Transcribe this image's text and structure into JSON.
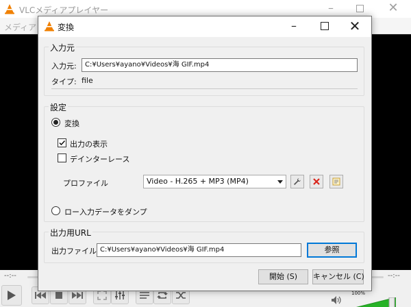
{
  "main_window": {
    "title": "VLCメディアプレイヤー",
    "menu_partial": "メディア (M",
    "time_left": "--:--",
    "time_right": "--:--",
    "volume_percent": "100%",
    "volume_level": 1.0
  },
  "dialog": {
    "title": "変換",
    "source": {
      "group_title": "入力元",
      "source_label": "入力元:",
      "source_value": "C:¥Users¥ayano¥Videos¥海  GIF.mp4",
      "type_label": "タイプ:",
      "type_value": "file"
    },
    "settings": {
      "group_title": "設定",
      "convert_label": "変換",
      "convert_selected": true,
      "show_output_label": "出力の表示",
      "show_output_checked": true,
      "deinterlace_label": "デインターレース",
      "deinterlace_checked": false,
      "profile_label": "プロファイル",
      "profile_value": "Video - H.265 + MP3 (MP4)",
      "raw_dump_label": "ロー入力データをダンプ",
      "raw_dump_selected": false
    },
    "output": {
      "group_title": "出力用URL",
      "file_label": "出力ファイル:",
      "file_value": "C:¥Users¥ayano¥Videos¥海  GIF.mp4",
      "browse_label": "参照"
    },
    "buttons": {
      "start_label": "開始 (S)",
      "cancel_label": "キャンセル (C)"
    }
  },
  "colors": {
    "vlc_orange": "#f08000",
    "accent_blue": "#0078d7",
    "delete_red": "#d9261c",
    "volume_green": "#27b227"
  }
}
